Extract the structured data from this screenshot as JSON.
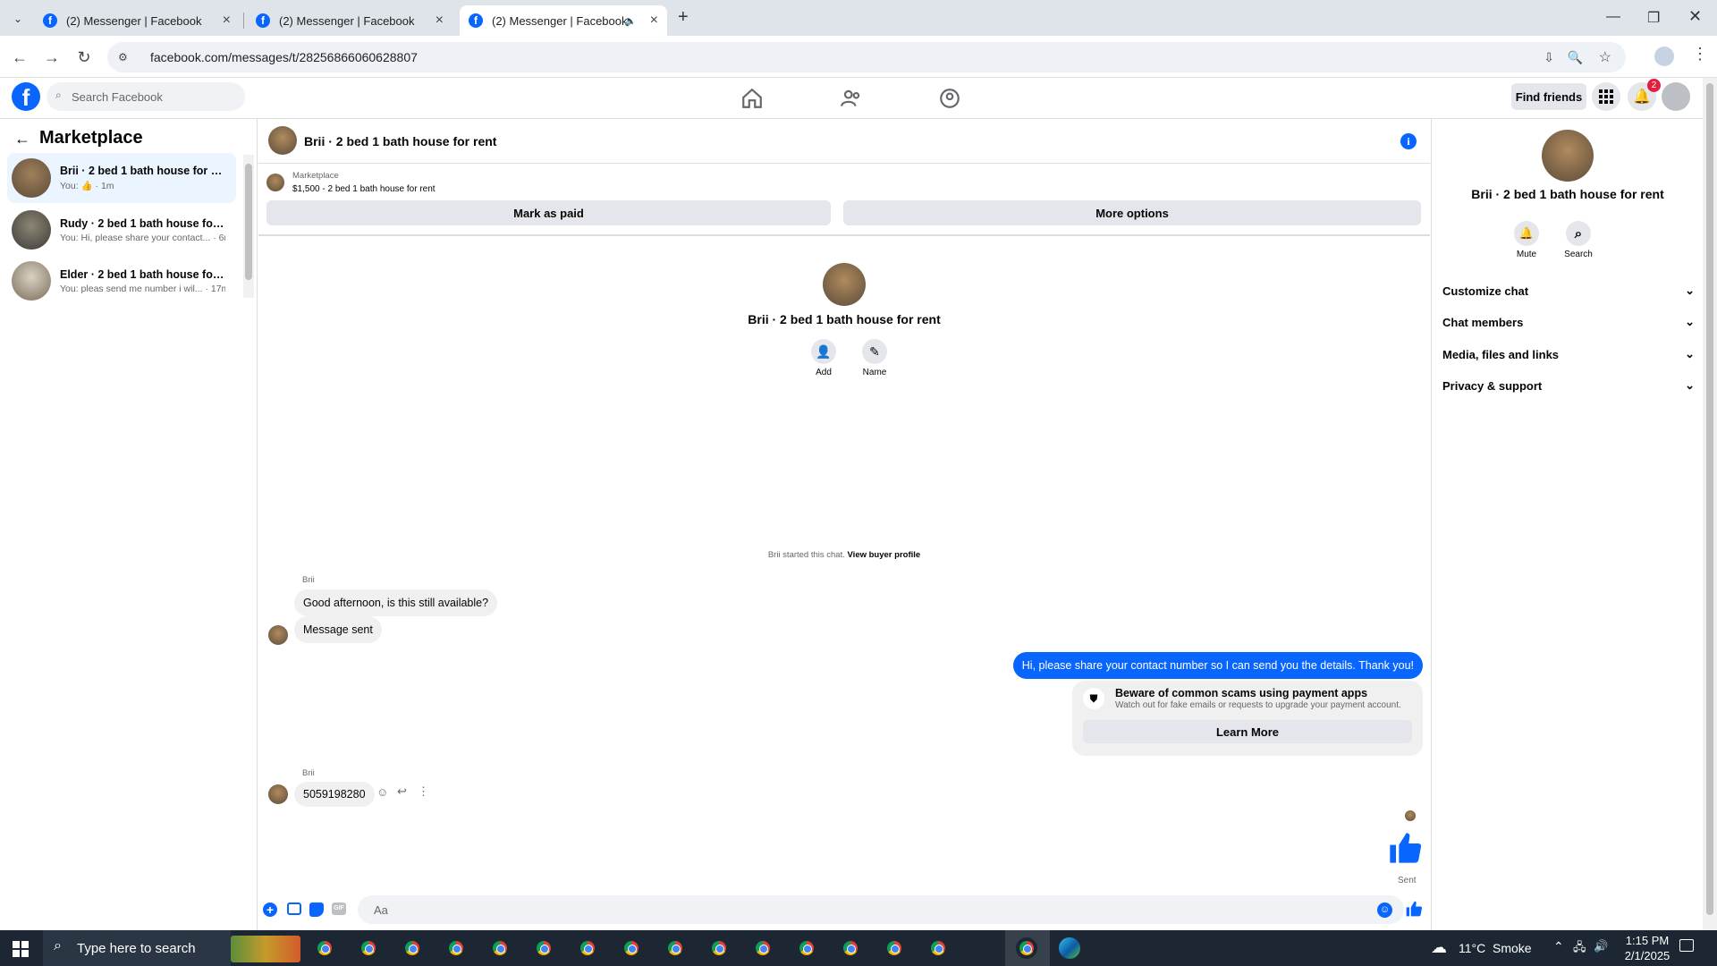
{
  "browser": {
    "tabs": [
      {
        "title": "(2) Messenger | Facebook"
      },
      {
        "title": "(2) Messenger | Facebook"
      },
      {
        "title": "(2) Messenger | Facebook",
        "active": true,
        "audio": true
      }
    ],
    "url": "facebook.com/messages/t/28256866060628807"
  },
  "fb": {
    "search_placeholder": "Search Facebook",
    "find_friends": "Find friends",
    "notif_count": "2"
  },
  "left": {
    "title": "Marketplace",
    "threads": [
      {
        "name": "Brii · 2 bed 1 bath house for rent",
        "preview": "You: 👍 · 1m",
        "selected": true
      },
      {
        "name": "Rudy · 2 bed 1 bath house for r...",
        "preview": "You: Hi, please share your contact... · 6m"
      },
      {
        "name": "Elder · 2 bed 1 bath house for r...",
        "preview": "You: pleas send me number i wil... · 17m"
      }
    ]
  },
  "chat": {
    "title": "Brii · 2 bed 1 bath house for rent",
    "mp_label": "Marketplace",
    "mp_listing": "$1,500 - 2 bed 1 bath house for rent",
    "mark_paid": "Mark as paid",
    "more_options": "More options",
    "intro_name": "Brii · 2 bed 1 bath house for rent",
    "add_label": "Add",
    "name_label": "Name",
    "started_text": "Brii started this chat.",
    "view_profile": "View buyer profile",
    "sender1": "Brii",
    "msg1": "Good afternoon, is this still available?",
    "msg2": "Message sent",
    "my_msg": "Hi, please share your contact number so I can send you the details. Thank you!",
    "scam_title": "Beware of common scams using payment apps",
    "scam_body": "Watch out for fake emails or requests to upgrade your payment account.",
    "learn_more": "Learn More",
    "sender2": "Brii",
    "msg3": "5059198280",
    "sent_label": "Sent",
    "input_placeholder": "Aa"
  },
  "right": {
    "name": "Brii · 2 bed 1 bath house for rent",
    "mute": "Mute",
    "search": "Search",
    "sections": [
      "Customize chat",
      "Chat members",
      "Media, files and links",
      "Privacy & support"
    ]
  },
  "taskbar": {
    "search_placeholder": "Type here to search",
    "weather": "11°C  Smoke",
    "time": "1:15 PM",
    "date": "2/1/2025"
  },
  "colors": {
    "brand": "#0866ff",
    "bubble_gray": "#f0f0f0",
    "badge": "#e41e3f"
  }
}
